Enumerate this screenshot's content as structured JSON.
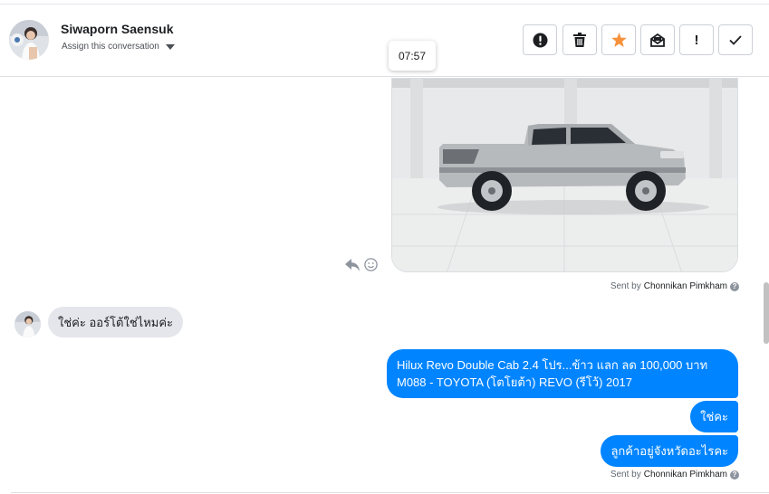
{
  "header": {
    "contact_name": "Siwaporn Saensuk",
    "assign_label": "Assign this conversation",
    "tools": [
      {
        "name": "mark-spam",
        "icon": "exclamation-circle-icon"
      },
      {
        "name": "delete",
        "icon": "trash-icon"
      },
      {
        "name": "star",
        "icon": "star-icon",
        "color": "#f7923b"
      },
      {
        "name": "mark-unread",
        "icon": "envelope-icon"
      },
      {
        "name": "follow-up",
        "icon": "exclamation-icon",
        "label": "!"
      },
      {
        "name": "mark-done",
        "icon": "checkmark-icon"
      }
    ]
  },
  "tooltip": {
    "time": "07:57"
  },
  "conversation": {
    "sent_by_prefix": "Sent by",
    "sent_by_name": "Chonnikan Pimkham",
    "incoming_message": "ใช่ค่ะ ออร์โต้ใช่ไหมค่ะ",
    "outgoing_messages": [
      {
        "line1": "Hilux Revo Double Cab 2.4 โปร...ข้าว แลก ลด 100,000 บาท",
        "line2": "M088 - TOYOTA (โตโยต้า) REVO (รีโว้) 2017"
      },
      {
        "line1": "ใช่คะ"
      },
      {
        "line1": "ลูกค้าอยู่จังหวัดอะไรคะ"
      }
    ]
  },
  "colors": {
    "accent_blue": "#0084ff",
    "star_orange": "#f7923b",
    "incoming_bubble": "#e4e6eb"
  }
}
